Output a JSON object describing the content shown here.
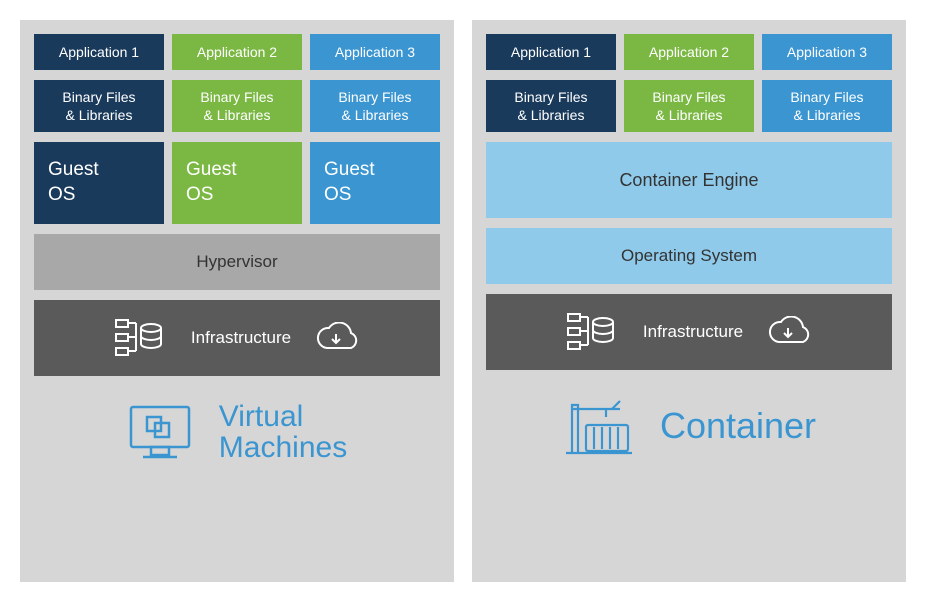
{
  "vm": {
    "app1": "Application 1",
    "app2": "Application 2",
    "app3": "Application 3",
    "bin": "Binary Files\n& Libraries",
    "guest": "Guest\nOS",
    "hypervisor": "Hypervisor",
    "infra": "Infrastructure",
    "title": "Virtual\nMachines"
  },
  "ct": {
    "app1": "Application 1",
    "app2": "Application 2",
    "app3": "Application 3",
    "bin": "Binary Files\n& Libraries",
    "engine": "Container Engine",
    "os": "Operating System",
    "infra": "Infrastructure",
    "title": "Container"
  }
}
